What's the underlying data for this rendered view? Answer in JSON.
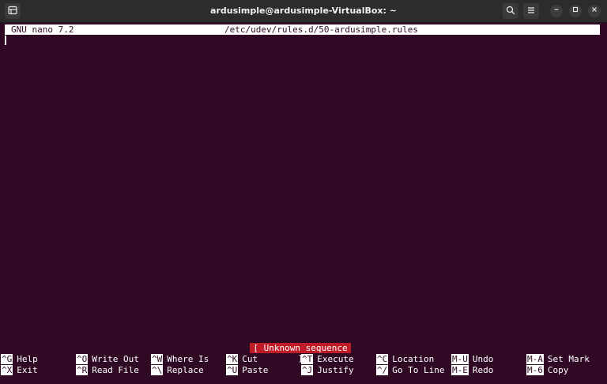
{
  "window": {
    "title": "ardusimple@ardusimple-VirtualBox: ~",
    "icons": {
      "new_tab": "terminal-tab-icon",
      "search": "search-icon",
      "menu": "hamburger-menu-icon",
      "minimize": "minimize-icon",
      "maximize": "maximize-icon",
      "close": "close-icon"
    }
  },
  "nano": {
    "version": "GNU nano 7.2",
    "filename": "/etc/udev/rules.d/50-ardusimple.rules",
    "status_message": "[ Unknown sequence ]",
    "shortcuts_row1": [
      {
        "key": "^G",
        "label": "Help"
      },
      {
        "key": "^O",
        "label": "Write Out"
      },
      {
        "key": "^W",
        "label": "Where Is"
      },
      {
        "key": "^K",
        "label": "Cut"
      },
      {
        "key": "^T",
        "label": "Execute"
      },
      {
        "key": "^C",
        "label": "Location"
      },
      {
        "key": "M-U",
        "label": "Undo"
      },
      {
        "key": "M-A",
        "label": "Set Mark"
      }
    ],
    "shortcuts_row2": [
      {
        "key": "^X",
        "label": "Exit"
      },
      {
        "key": "^R",
        "label": "Read File"
      },
      {
        "key": "^\\",
        "label": "Replace"
      },
      {
        "key": "^U",
        "label": "Paste"
      },
      {
        "key": "^J",
        "label": "Justify"
      },
      {
        "key": "^/",
        "label": "Go To Line"
      },
      {
        "key": "M-E",
        "label": "Redo"
      },
      {
        "key": "M-6",
        "label": "Copy"
      }
    ]
  },
  "colors": {
    "terminal_bg": "#300a24",
    "titlebar_bg": "#2c2c2c",
    "highlight_fg": "#ffffff",
    "status_bg": "#c01c28"
  }
}
